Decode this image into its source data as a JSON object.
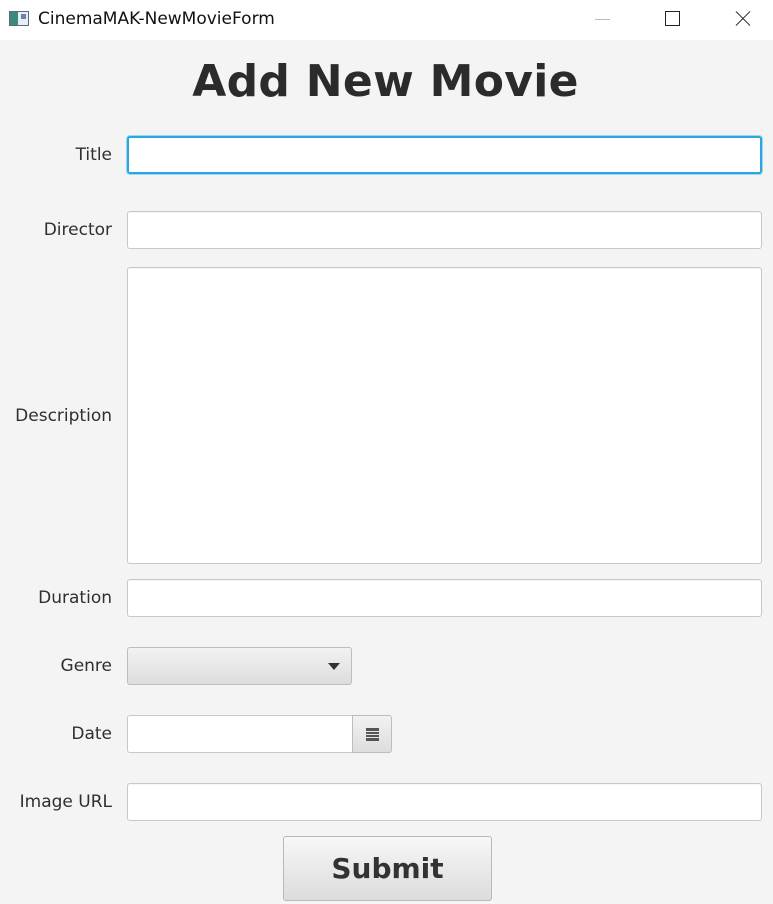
{
  "window": {
    "title": "CinemaMAK-NewMovieForm",
    "app_icon": "app-window-icon"
  },
  "form": {
    "heading": "Add New Movie",
    "fields": {
      "title": {
        "label": "Title",
        "value": ""
      },
      "director": {
        "label": "Director",
        "value": ""
      },
      "description": {
        "label": "Description",
        "value": ""
      },
      "duration": {
        "label": "Duration",
        "value": ""
      },
      "genre": {
        "label": "Genre",
        "selected": ""
      },
      "date": {
        "label": "Date",
        "value": ""
      },
      "image_url": {
        "label": "Image URL",
        "value": ""
      }
    },
    "submit_label": "Submit"
  },
  "icons": {
    "minimize": "minimize-icon",
    "maximize": "maximize-icon",
    "close": "close-icon",
    "genre_dropdown": "chevron-down-icon",
    "date_picker": "calendar-icon"
  },
  "colors": {
    "background": "#f4f4f4",
    "focus": "#2aa6e0",
    "heading": "#2b2b2b"
  }
}
